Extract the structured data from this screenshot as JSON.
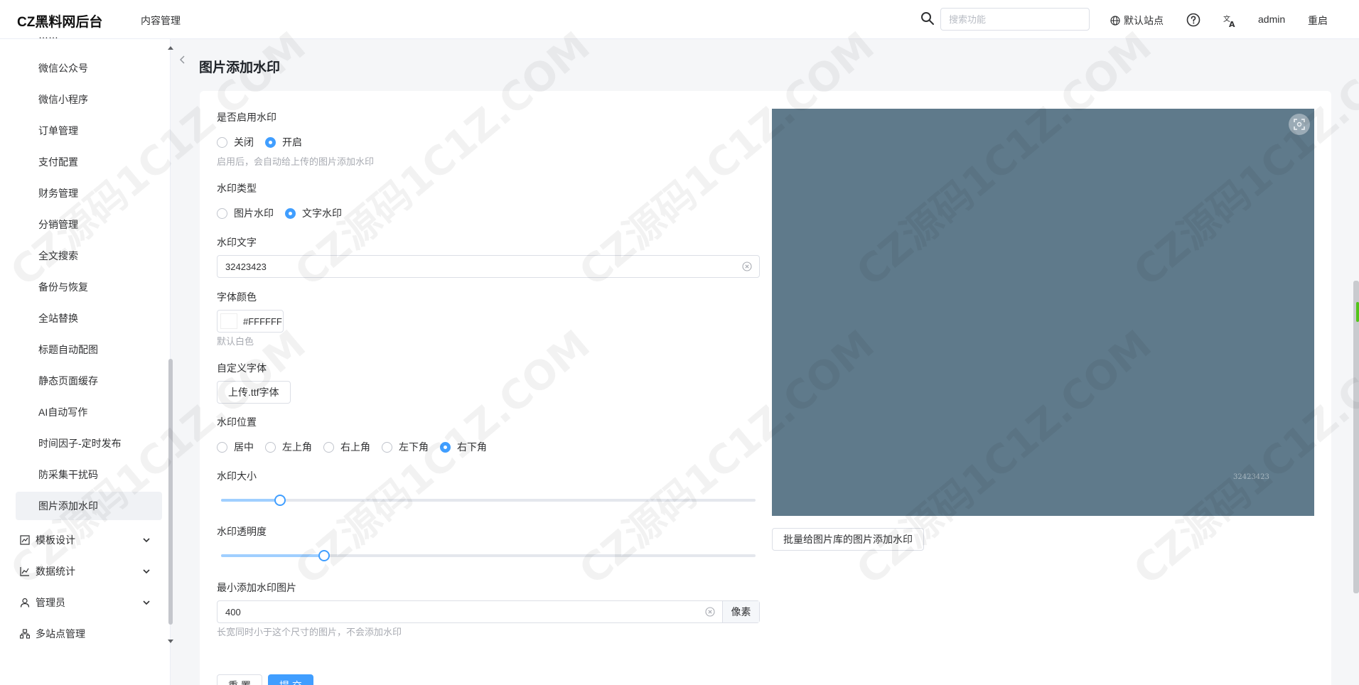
{
  "header": {
    "logo": "CZ黑料网后台",
    "nav_item": "内容管理",
    "search_placeholder": "搜索功能",
    "site_label": "默认站点",
    "user": "admin",
    "restart": "重启"
  },
  "sidebar": {
    "items": [
      {
        "label": "微信公众号"
      },
      {
        "label": "微信小程序"
      },
      {
        "label": "订单管理"
      },
      {
        "label": "支付配置"
      },
      {
        "label": "财务管理"
      },
      {
        "label": "分销管理"
      },
      {
        "label": "全文搜索"
      },
      {
        "label": "备份与恢复"
      },
      {
        "label": "全站替换"
      },
      {
        "label": "标题自动配图"
      },
      {
        "label": "静态页面缓存"
      },
      {
        "label": "AI自动写作"
      },
      {
        "label": "时间因子-定时发布"
      },
      {
        "label": "防采集干扰码"
      },
      {
        "label": "图片添加水印"
      }
    ],
    "groups": [
      {
        "label": "模板设计"
      },
      {
        "label": "数据统计"
      },
      {
        "label": "管理员"
      },
      {
        "label": "多站点管理"
      }
    ]
  },
  "page": {
    "title": "图片添加水印"
  },
  "form": {
    "enable": {
      "label": "是否启用水印",
      "options": [
        "关闭",
        "开启"
      ],
      "selected": "开启",
      "hint": "启用后，会自动给上传的图片添加水印"
    },
    "type": {
      "label": "水印类型",
      "options": [
        "图片水印",
        "文字水印"
      ],
      "selected": "文字水印"
    },
    "text": {
      "label": "水印文字",
      "value": "32423423"
    },
    "color": {
      "label": "字体颜色",
      "value": "#FFFFFF",
      "hint": "默认白色"
    },
    "font": {
      "label": "自定义字体",
      "button": "上传.ttf字体"
    },
    "position": {
      "label": "水印位置",
      "options": [
        "居中",
        "左上角",
        "右上角",
        "左下角",
        "右下角"
      ],
      "selected": "右下角"
    },
    "size": {
      "label": "水印大小",
      "value_fraction": 0.11
    },
    "opacity": {
      "label": "水印透明度",
      "value_fraction": 0.193
    },
    "min_size": {
      "label": "最小添加水印图片",
      "value": "400",
      "unit": "像素",
      "hint": "长宽同时小于这个尺寸的图片，不会添加水印"
    },
    "reset_button": "重 置",
    "submit_button": "提 交"
  },
  "preview": {
    "watermark_text": "32423423",
    "background_color": "#5f7a8b",
    "batch_button": "批量给图片库的图片添加水印"
  },
  "colors": {
    "primary": "#409eff"
  }
}
